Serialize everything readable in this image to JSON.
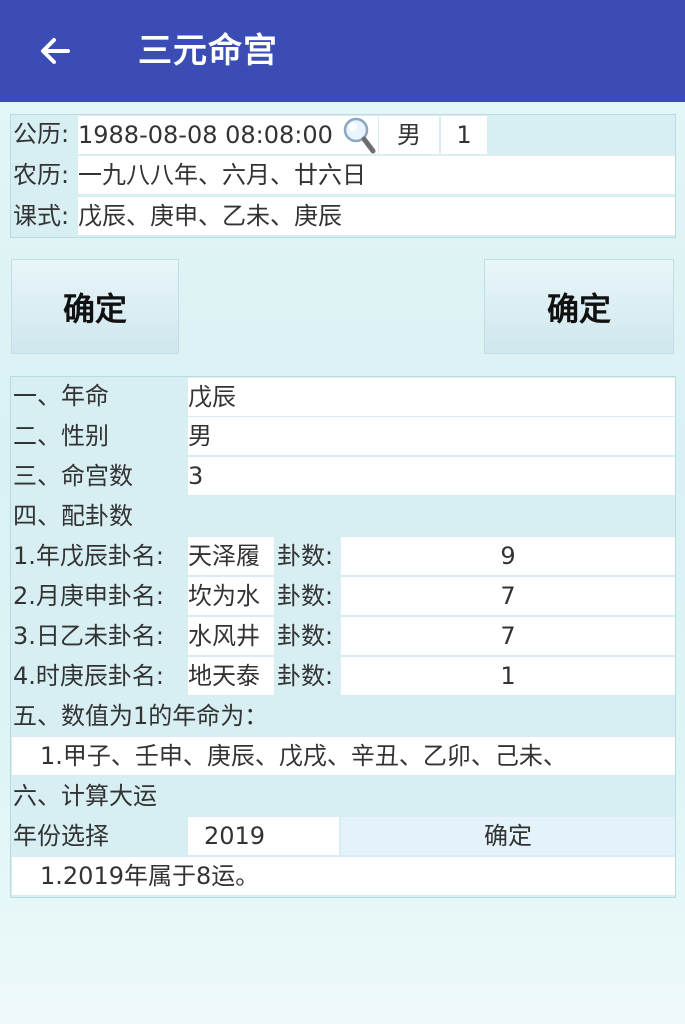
{
  "appbar": {
    "title": "三元命宫",
    "back_icon": "arrow-left-icon"
  },
  "header_form": {
    "solar_label": "公历:",
    "solar_value": "1988-08-08  08:08:00",
    "gender_value": "男",
    "number_value": "1",
    "lunar_label": "农历:",
    "lunar_value": "一九八八年、六月、廿六日",
    "pattern_label": "课式:",
    "pattern_value": "戊辰、庚申、乙未、庚辰"
  },
  "buttons": {
    "confirm_left": "确定",
    "confirm_right": "确定"
  },
  "results": {
    "year_fate_label": "一、年命",
    "year_fate_value": "戊辰",
    "gender_label": "二、性别",
    "gender_value": "男",
    "palace_label": "三、命宫数",
    "palace_value": "3",
    "trigram_heading": "四、配卦数",
    "trigrams": [
      {
        "label": "1.年戊辰卦名:",
        "name": "天泽履",
        "count_label": "卦数:",
        "count": "9"
      },
      {
        "label": "2.月庚申卦名:",
        "name": "坎为水",
        "count_label": "卦数:",
        "count": "7"
      },
      {
        "label": "3.日乙未卦名:",
        "name": "水风井",
        "count_label": "卦数:",
        "count": "7"
      },
      {
        "label": "4.时庚辰卦名:",
        "name": "地天泰",
        "count_label": "卦数:",
        "count": "1"
      }
    ],
    "value1_heading": "五、数值为1的年命为：",
    "value1_list": "1.甲子、壬申、庚辰、戊戌、辛丑、乙卯、己未、",
    "luck_heading": "六、计算大运",
    "year_select_label": "年份选择",
    "year_select_value": "2019",
    "year_confirm": "确定",
    "luck_result": "1.2019年属于8运。"
  },
  "colors": {
    "appbar": "#3b4db5",
    "label_bg": "#d7eef3",
    "cell_bg": "#ffffff"
  }
}
